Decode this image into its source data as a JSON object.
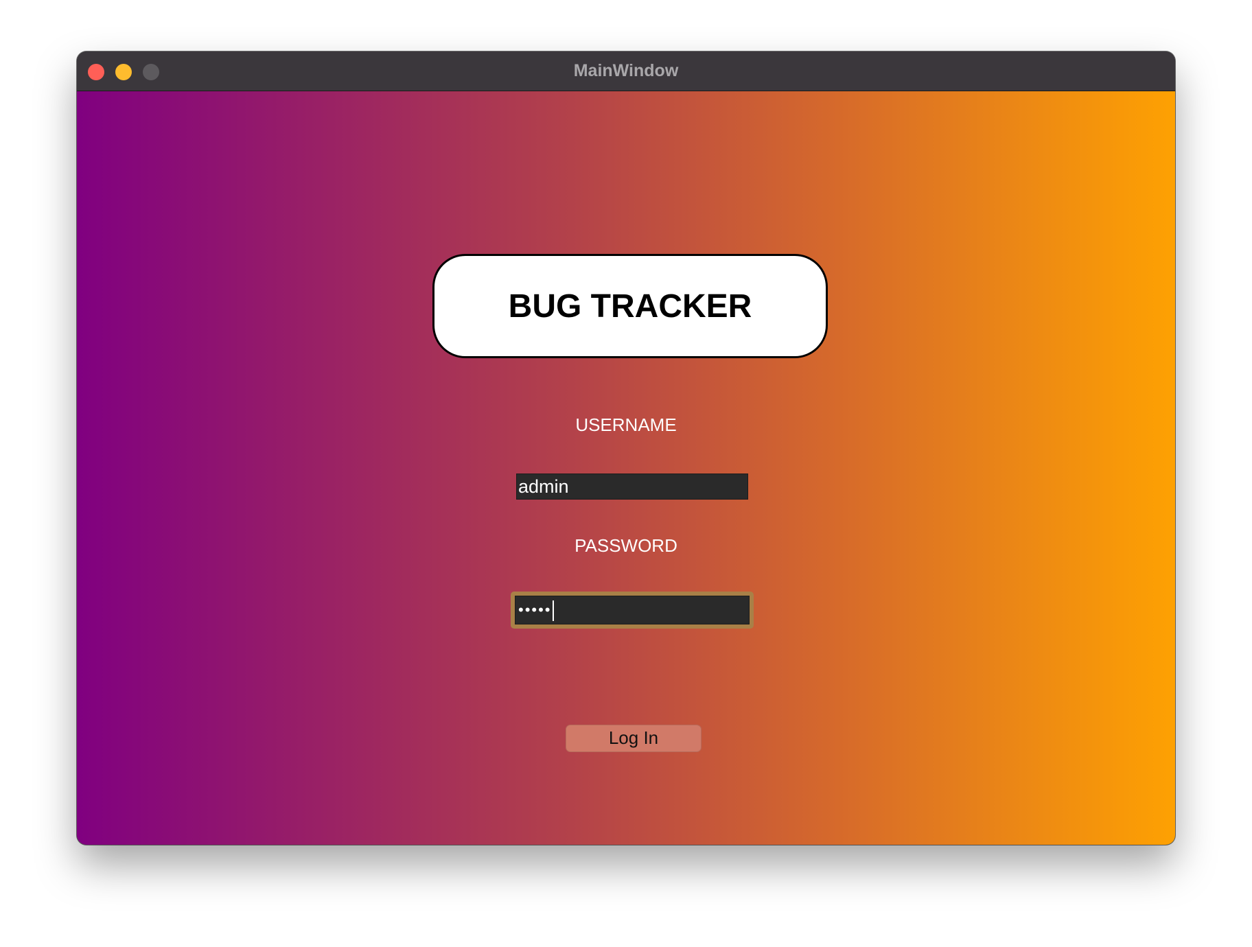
{
  "window": {
    "title": "MainWindow"
  },
  "app": {
    "title": "BUG TRACKER"
  },
  "form": {
    "username_label": "USERNAME",
    "username_value": "admin",
    "password_label": "PASSWORD",
    "password_masked": "•••••",
    "login_label": "Log In"
  },
  "colors": {
    "gradient_start": "#800080",
    "gradient_end": "#fea102",
    "input_bg": "#2a2a2a",
    "focus_ring": "#a98047",
    "button_bg": "#d17a68"
  },
  "icons": {
    "close": "close-icon",
    "minimize": "minimize-icon",
    "zoom": "zoom-icon"
  }
}
